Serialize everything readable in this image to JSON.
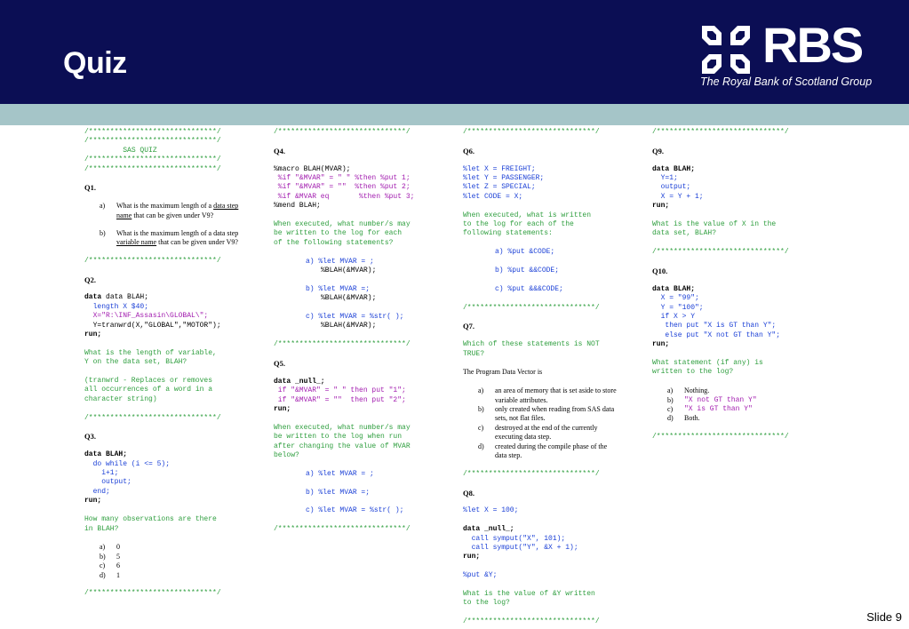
{
  "header": {
    "title": "Quiz"
  },
  "logo": {
    "text": "RBS",
    "subtitle": "The Royal Bank of Scotland Group"
  },
  "divider": "/******************************/",
  "col1": {
    "banner": "SAS QUIZ",
    "q1": {
      "title": "Q1.",
      "a": {
        "label": "a)",
        "text_before": "What is the maximum length of a ",
        "underlined": "data step name",
        "text_after": " that can be given under V9?"
      },
      "b": {
        "label": "b)",
        "text_before": "What is the maximum length of a data step ",
        "underlined": "variable name",
        "text_after": " that can be given under V9?"
      }
    },
    "q2": {
      "title": "Q2.",
      "code_lines": [
        "data BLAH;",
        "  length X $40;",
        "  X=\"R:\\INF_Assasin\\GLOBAL\\\";",
        "  Y=tranwrd(X,\"GLOBAL\",\"MOTOR\");",
        "run;"
      ],
      "question": "What is the length of variable,\nY on the data set, BLAH?",
      "note": "(tranwrd - Replaces or removes\nall occurrences of a word in a\ncharacter string)"
    },
    "q3": {
      "title": "Q3.",
      "code_lines": [
        "data BLAH;",
        "  do while (i <= 5);",
        "    i+1;",
        "    output;",
        "  end;",
        "run;"
      ],
      "question": "How many observations are there\nin BLAH?",
      "options": [
        {
          "label": "a)",
          "text": "0"
        },
        {
          "label": "b)",
          "text": "5"
        },
        {
          "label": "c)",
          "text": "6"
        },
        {
          "label": "d)",
          "text": "1"
        }
      ]
    }
  },
  "col2": {
    "q4": {
      "title": "Q4.",
      "code_lines": [
        "%macro BLAH(MVAR);",
        " %if \"&MVAR\" = \" \" %then %put 1;",
        " %if \"&MVAR\" = \"\"  %then %put 2;",
        " %if &MVAR eq       %then %put 3;",
        "%mend BLAH;"
      ],
      "question": "When executed, what number/s may\nbe written to the log for each\nof the following statements?",
      "options": [
        {
          "label": "a)",
          "line1": "%let MVAR = ;",
          "line2": "%BLAH(&MVAR);"
        },
        {
          "label": "b)",
          "line1": "%let MVAR =;",
          "line2": "%BLAH(&MVAR);"
        },
        {
          "label": "c)",
          "line1": "%let MVAR = %str( );",
          "line2": "%BLAH(&MVAR);"
        }
      ]
    },
    "q5": {
      "title": "Q5.",
      "code_lines": [
        "data _null_;",
        " if \"&MVAR\" = \" \" then put \"1\";",
        " if \"&MVAR\" = \"\"  then put \"2\";",
        "run;"
      ],
      "question": "When executed, what number/s may\nbe written to the log when run\nafter changing the value of MVAR\nbelow?",
      "options": [
        {
          "label": "a)",
          "text": "%let MVAR = ;"
        },
        {
          "label": "b)",
          "text": "%let MVAR =;"
        },
        {
          "label": "c)",
          "text": "%let MVAR = %str( );"
        }
      ]
    }
  },
  "col3": {
    "q6": {
      "title": "Q6.",
      "code_lines": [
        "%let X = FREIGHT;",
        "%let Y = PASSENGER;",
        "%let Z = SPECIAL;",
        "%let CODE = X;"
      ],
      "question": "When executed, what is written\nto the log for each of the\nfollowing statements:",
      "options": [
        {
          "label": "a)",
          "text": "%put &CODE;"
        },
        {
          "label": "b)",
          "text": "%put &&CODE;"
        },
        {
          "label": "c)",
          "text": "%put &&&CODE;"
        }
      ]
    },
    "q7": {
      "title": "Q7.",
      "question": "Which of these statements is NOT\nTRUE?",
      "intro": "The Program Data Vector is",
      "options": [
        {
          "label": "a)",
          "text": "an area of memory that is set aside to store variable attributes."
        },
        {
          "label": "b)",
          "text": "only created when reading from SAS data sets, not flat files."
        },
        {
          "label": "c)",
          "text": "destroyed at the end of the currently executing data step."
        },
        {
          "label": "d)",
          "text": "created during the compile phase of the data step."
        }
      ]
    },
    "q8": {
      "title": "Q8.",
      "code_lines": [
        "%let X = 100;",
        "",
        "data _null_;",
        "  call symput(\"X\", 101);",
        "  call symput(\"Y\", &X + 1);",
        "run;",
        "",
        "%put &Y;"
      ],
      "question": "What is the value of &Y written\nto the log?"
    }
  },
  "col4": {
    "q9": {
      "title": "Q9.",
      "code_lines": [
        "data BLAH;",
        "  Y=1;",
        "  output;",
        "  X = Y + 1;",
        "run;"
      ],
      "question": "What is the value of X in the\ndata set, BLAH?"
    },
    "q10": {
      "title": "Q10.",
      "code_lines": [
        "data BLAH;",
        "  X = \"99\";",
        "  Y = \"100\";",
        "  if X > Y",
        "   then put \"X is GT than Y\";",
        "   else put \"X not GT than Y\";",
        "run;"
      ],
      "question": "What statement (if any) is\nwritten to the log?",
      "options": [
        {
          "label": "a)",
          "text": "Nothing."
        },
        {
          "label": "b)",
          "text": "\"X not GT than Y\""
        },
        {
          "label": "c)",
          "text": "\"X is GT than Y\""
        },
        {
          "label": "d)",
          "text": "Both."
        }
      ]
    }
  },
  "footer": {
    "slide_label": "Slide 9"
  },
  "colors": {
    "header_bg": "#0b0e54",
    "band": "#a5c5c8",
    "comment_green": "#2e9e3e",
    "keyword_blue": "#1a3fd6",
    "string_magenta": "#a21caf"
  }
}
